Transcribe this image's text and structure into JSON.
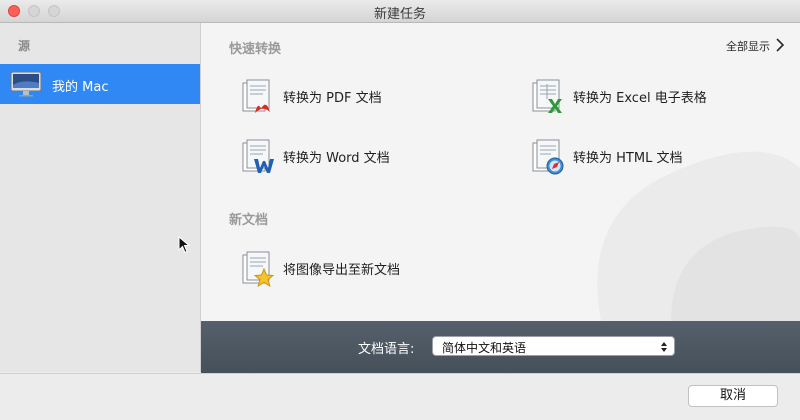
{
  "window": {
    "title": "新建任务"
  },
  "sidebar": {
    "header": "源",
    "items": [
      {
        "label": "我的 Mac",
        "icon": "imac-icon",
        "selected": true
      }
    ]
  },
  "main": {
    "quick_convert": {
      "title": "快速转换",
      "show_all": "全部显示",
      "actions": [
        {
          "label": "转换为 PDF 文档",
          "icon": "pdf-document-icon"
        },
        {
          "label": "转换为 Excel 电子表格",
          "icon": "excel-document-icon"
        },
        {
          "label": "转换为 Word 文档",
          "icon": "word-document-icon"
        },
        {
          "label": "转换为 HTML 文档",
          "icon": "html-document-icon"
        }
      ]
    },
    "new_doc": {
      "title": "新文档",
      "actions": [
        {
          "label": "将图像导出至新文档",
          "icon": "image-export-icon"
        }
      ]
    }
  },
  "language": {
    "label": "文档语言:",
    "selected": "简体中文和英语"
  },
  "footer": {
    "cancel_label": "取消"
  },
  "colors": {
    "accent": "#2f88f4",
    "language_bar": "#4e5863",
    "close": "#ff5f57"
  }
}
